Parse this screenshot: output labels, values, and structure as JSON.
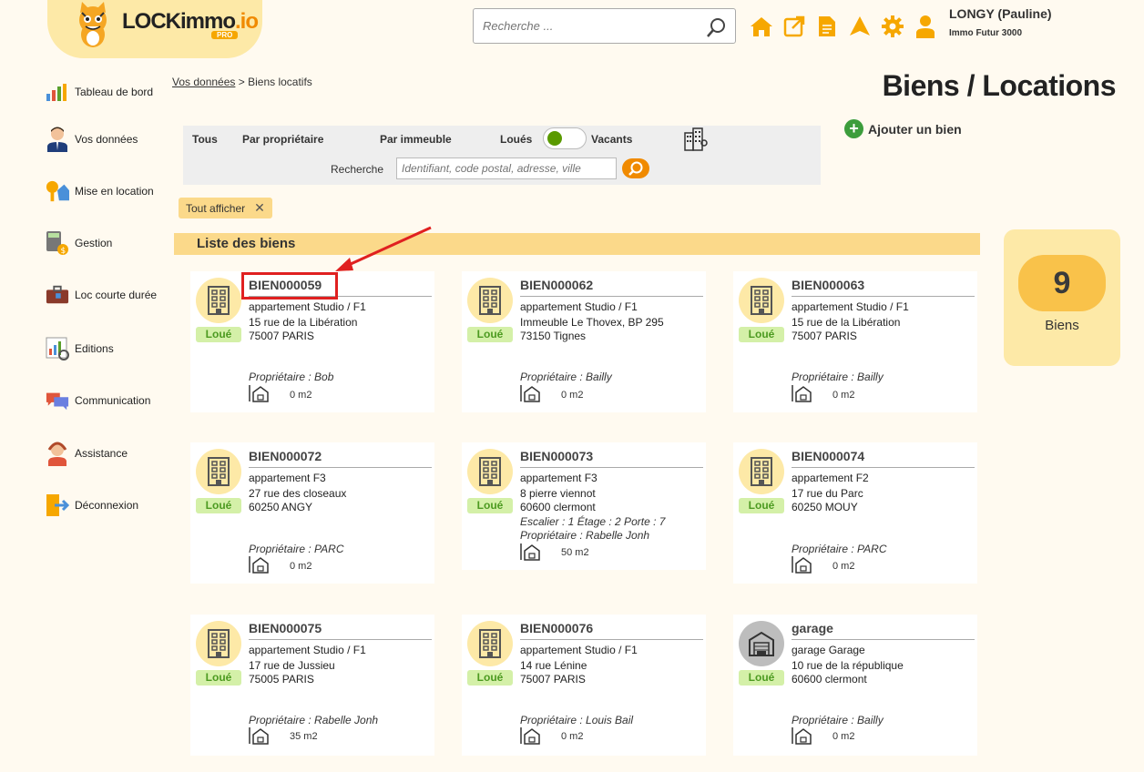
{
  "header": {
    "logo_text": "LOCKimmo",
    "logo_suffix": ".io",
    "logo_badge": "PRO",
    "search_placeholder": "Recherche ...",
    "user_name": "LONGY (Pauline)",
    "user_org": "Immo Futur 3000",
    "icons": [
      "home-icon",
      "external-link-icon",
      "document-icon",
      "alert-icon",
      "gear-icon",
      "user-icon"
    ],
    "accent": "#f08a00"
  },
  "sidebar": {
    "items": [
      {
        "label": "Tableau de bord",
        "icon": "dashboard-icon"
      },
      {
        "label": "Vos données",
        "icon": "person-icon"
      },
      {
        "label": "Mise en location",
        "icon": "keys-icon"
      },
      {
        "label": "Gestion",
        "icon": "calculator-icon"
      },
      {
        "label": "Loc courte durée",
        "icon": "suitcase-icon"
      },
      {
        "label": "Editions",
        "icon": "report-icon"
      },
      {
        "label": "Communication",
        "icon": "chat-icon"
      },
      {
        "label": "Assistance",
        "icon": "headset-icon"
      },
      {
        "label": "Déconnexion",
        "icon": "logout-icon"
      }
    ]
  },
  "breadcrumb": {
    "link": "Vos données",
    "separator": ">",
    "current": "Biens locatifs"
  },
  "page_title": "Biens / Locations",
  "add_button": "Ajouter un bien",
  "filters": {
    "tabs": [
      "Tous",
      "Par propriétaire",
      "Par immeuble"
    ],
    "toggle_left": "Loués",
    "toggle_right": "Vacants",
    "search_label": "Recherche",
    "search_placeholder": "Identifiant, code postal, adresse, ville"
  },
  "chip": "Tout afficher",
  "list_header": "Liste des biens",
  "count": {
    "value": "9",
    "label": "Biens"
  },
  "cards": [
    {
      "ref": "BIEN000059",
      "type": "appartement Studio / F1",
      "addr1": "15 rue de la Libération",
      "addr2": "75007 PARIS",
      "extra": "",
      "owner": "Propriétaire : Bob",
      "area": "0 m2",
      "status": "Loué"
    },
    {
      "ref": "BIEN000062",
      "type": "appartement Studio / F1",
      "addr1": "Immeuble Le Thovex, BP 295",
      "addr2": "73150 Tignes",
      "extra": "",
      "owner": "Propriétaire : Bailly",
      "area": "0 m2",
      "status": "Loué"
    },
    {
      "ref": "BIEN000063",
      "type": "appartement Studio / F1",
      "addr1": "15 rue de la Libération",
      "addr2": "75007 PARIS",
      "extra": "",
      "owner": "Propriétaire : Bailly",
      "area": "0 m2",
      "status": "Loué"
    },
    {
      "ref": "BIEN000072",
      "type": "appartement F3",
      "addr1": "27 rue des closeaux",
      "addr2": "60250 ANGY",
      "extra": "",
      "owner": "Propriétaire : PARC",
      "area": "0 m2",
      "status": "Loué"
    },
    {
      "ref": "BIEN000073",
      "type": "appartement F3",
      "addr1": "8 pierre viennot",
      "addr2": "60600 clermont",
      "extra": "Escalier : 1 Étage : 2 Porte : 7",
      "owner": "Propriétaire : Rabelle Jonh",
      "area": "50 m2",
      "status": "Loué"
    },
    {
      "ref": "BIEN000074",
      "type": "appartement F2",
      "addr1": "17 rue du Parc",
      "addr2": "60250 MOUY",
      "extra": "",
      "owner": "Propriétaire : PARC",
      "area": "0 m2",
      "status": "Loué"
    },
    {
      "ref": "BIEN000075",
      "type": "appartement Studio / F1",
      "addr1": "17 rue de Jussieu",
      "addr2": "75005 PARIS",
      "extra": "",
      "owner": "Propriétaire : Rabelle Jonh",
      "area": "35 m2",
      "status": "Loué"
    },
    {
      "ref": "BIEN000076",
      "type": "appartement Studio / F1",
      "addr1": "14 rue Lénine",
      "addr2": "75007 PARIS",
      "extra": "",
      "owner": "Propriétaire : Louis Bail",
      "area": "0 m2",
      "status": "Loué"
    },
    {
      "ref": "garage",
      "type": "garage Garage",
      "addr1": "10 rue de la république",
      "addr2": "60600 clermont",
      "extra": "",
      "owner": "Propriétaire : Bailly",
      "area": "0 m2",
      "status": "Loué"
    }
  ]
}
